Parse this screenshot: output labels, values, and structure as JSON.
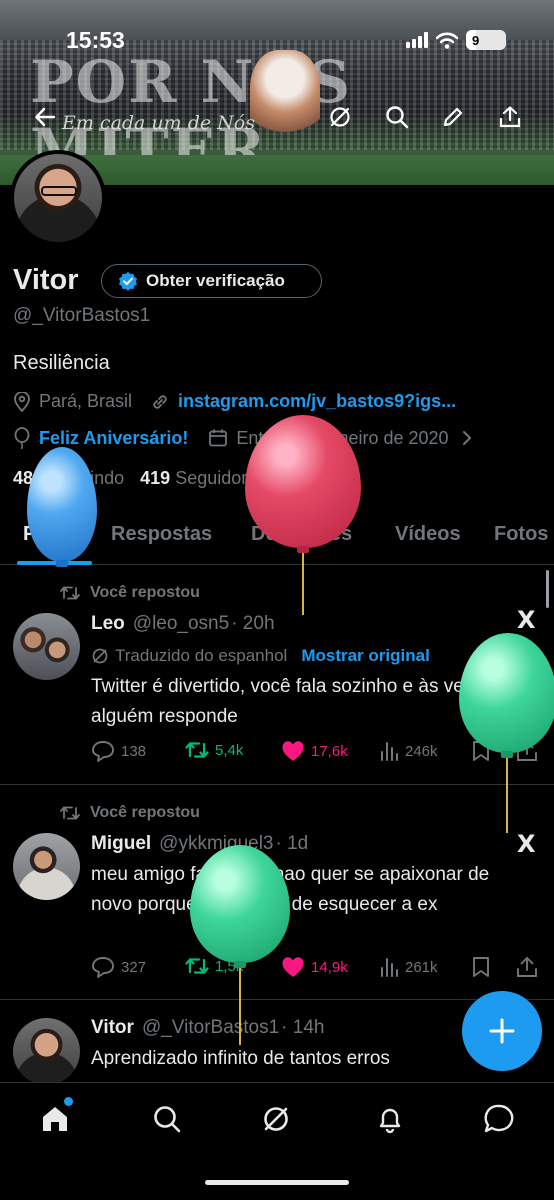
{
  "status_bar": {
    "time": "15:53",
    "battery": "9"
  },
  "banner": {
    "big_text": "POR NOS MITER GERAIS",
    "motto": "Em cada um de Nós"
  },
  "profile": {
    "name": "Vitor",
    "verify_label": "Obter verificação",
    "handle": "@_VitorBastos1",
    "bio": "Resiliência",
    "location": "Pará, Brasil",
    "website": "instagram.com/jv_bastos9?igs...",
    "birthday": "Feliz Aniversário!",
    "joined": "Entrou em janeiro de 2020",
    "following_count": "489",
    "following_label": "Seguindo",
    "followers_count": "419",
    "followers_label": "Seguidores"
  },
  "tabs": [
    "Posts",
    "Respostas",
    "Destaques",
    "Vídeos",
    "Fotos"
  ],
  "tweets": [
    {
      "repost_label": "Você repostou",
      "name": "Leo",
      "handle": "@leo_osn5",
      "time": "· 20h",
      "translated_label": "Traduzido do espanhol",
      "show_original": "Mostrar original",
      "text": "Twitter é divertido, você fala sozinho e às vezes alguém responde",
      "replies": "138",
      "reposts": "5,4k",
      "likes": "17,6k",
      "views": "246k"
    },
    {
      "repost_label": "Você repostou",
      "name": "Miguel",
      "handle": "@ykkmiguel3",
      "time": "· 1d",
      "text": "meu amigo falou que nao quer se apaixonar de novo porque tem medo de esquecer a ex",
      "replies": "327",
      "reposts": "1,5k",
      "likes": "14,9k",
      "views": "261k"
    },
    {
      "name": "Vitor",
      "handle": "@_VitorBastos1",
      "time": "· 14h",
      "text": "Aprendizado infinito de tantos erros"
    }
  ],
  "icons": {
    "back": "arrow-left-icon",
    "grok": "grok-icon",
    "search": "search-icon",
    "edit": "pencil-icon",
    "share": "share-icon",
    "x_logo": "X"
  },
  "colors": {
    "accent": "#1d9bf0",
    "repost_green": "#00ba7c",
    "like_pink": "#f91880",
    "muted": "#71767b",
    "text": "#e7e9ea"
  }
}
